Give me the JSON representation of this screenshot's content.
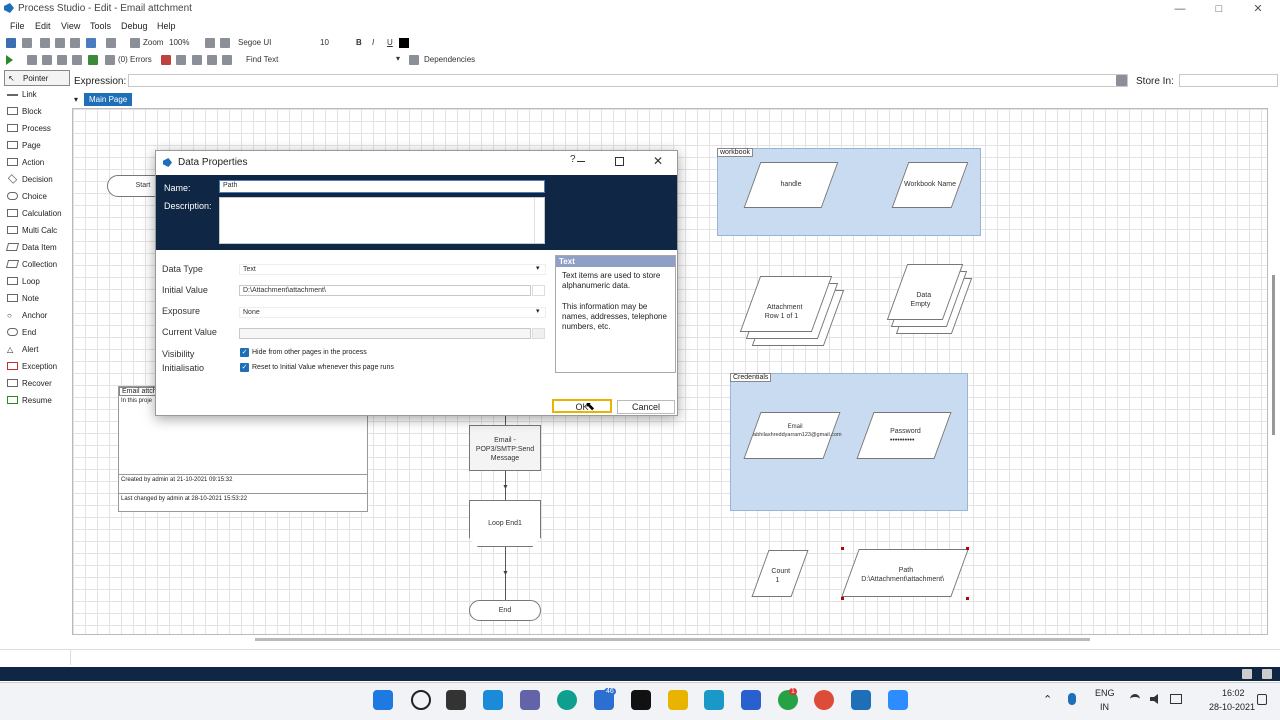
{
  "window": {
    "title": "Process Studio - Edit - Email attchment",
    "min": "—",
    "max": "□",
    "close": "✕"
  },
  "menu": [
    "File",
    "Edit",
    "View",
    "Tools",
    "Debug",
    "Help"
  ],
  "toolbar": {
    "zoom_label": "Zoom",
    "zoom_value": "100%",
    "font": "Segoe UI",
    "font_size": "10",
    "bold": "B",
    "italic": "I",
    "underline": "U",
    "errors": "(0) Errors",
    "find_text": "Find Text",
    "dependencies": "Dependencies"
  },
  "expression": {
    "label": "Expression:",
    "store_label": "Store In:"
  },
  "palette": [
    "Pointer",
    "Link",
    "Block",
    "Process",
    "Page",
    "Action",
    "Decision",
    "Choice",
    "Calculation",
    "Multi Calc",
    "Data Item",
    "Collection",
    "Loop",
    "Note",
    "Anchor",
    "End",
    "Alert",
    "Exception",
    "Recover",
    "Resume"
  ],
  "page_tab": "Main Page",
  "canvas": {
    "start": "Start",
    "info_title": "Email attchm",
    "info_desc": "In this proje",
    "created": "Created by admin at 21-10-2021 09:15:32",
    "changed": "Last changed by admin at 28-10-2021 15:53:22",
    "email_action": "Email - POP3/SMTP:Send Message",
    "loop_end": "Loop End1",
    "end": "End",
    "workbook_group": "workbook",
    "handle": "handle",
    "workbook_name": "Workbook Name",
    "attachment": "Attachment",
    "attachment_sub": "Row 1 of 1",
    "data": "Data",
    "data_sub": "Empty",
    "credentials_group": "Credentials",
    "email": "Email",
    "email_value": "abhilashreddyarram123@gmail.com",
    "password": "Password",
    "password_value": "••••••••••",
    "count": "Count",
    "count_value": "1",
    "path": "Path",
    "path_value": "D:\\Attachment\\attachment\\"
  },
  "dialog": {
    "title": "Data Properties",
    "help_btn": "?",
    "name_label": "Name:",
    "name_value": "Path",
    "desc_label": "Description:",
    "data_type_label": "Data Type",
    "data_type_value": "Text",
    "initial_label": "Initial Value",
    "initial_value": "D:\\Attachment\\attachment\\",
    "exposure_label": "Exposure",
    "exposure_value": "None",
    "current_label": "Current Value",
    "visibility_label": "Visibility",
    "visibility_text": "Hide from other pages in the process",
    "init_label": "Initialisatio",
    "init_text": "Reset to Initial Value whenever this page runs",
    "help_title": "Text",
    "help_p1": "Text items are used to store alphanumeric data.",
    "help_p2": "This information may be names, addresses, telephone numbers, etc.",
    "ok": "OK",
    "cancel": "Cancel"
  },
  "taskbar": {
    "lang1": "ENG",
    "lang2": "IN",
    "time": "16:02",
    "date": "28-10-2021",
    "badge_mail": "46",
    "badge_whatsapp": "1"
  },
  "colors": {
    "dialog_header": "#0f2744",
    "accent": "#1e6fb8",
    "group_fill": "#c9dbf1",
    "ok_border": "#e8b400"
  }
}
